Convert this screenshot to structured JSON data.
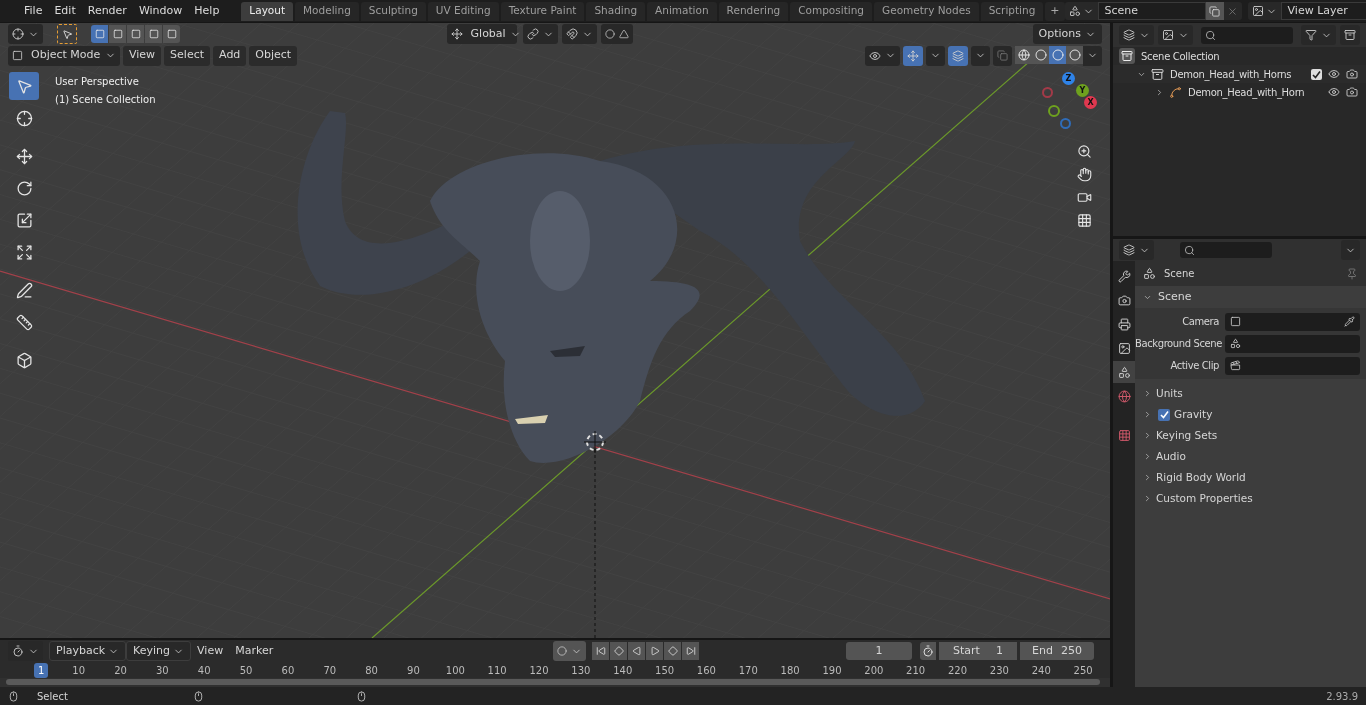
{
  "menu": [
    "File",
    "Edit",
    "Render",
    "Window",
    "Help"
  ],
  "workspaces": [
    {
      "label": "Layout",
      "selected": true
    },
    {
      "label": "Modeling",
      "selected": false
    },
    {
      "label": "Sculpting",
      "selected": false
    },
    {
      "label": "UV Editing",
      "selected": false
    },
    {
      "label": "Texture Paint",
      "selected": false
    },
    {
      "label": "Shading",
      "selected": false
    },
    {
      "label": "Animation",
      "selected": false
    },
    {
      "label": "Rendering",
      "selected": false
    },
    {
      "label": "Compositing",
      "selected": false
    },
    {
      "label": "Geometry Nodes",
      "selected": false
    },
    {
      "label": "Scripting",
      "selected": false
    }
  ],
  "add_workspace": "+",
  "scene_field": {
    "value": "Scene"
  },
  "view_layer_field": {
    "value": "View Layer"
  },
  "viewport": {
    "select_modes": [
      {
        "selected": true
      },
      {
        "selected": false
      },
      {
        "selected": false
      },
      {
        "selected": false
      },
      {
        "selected": false
      }
    ],
    "transform_orientation": "Global",
    "options": "Options",
    "mode": "Object Mode",
    "menus": [
      "View",
      "Select",
      "Add",
      "Object"
    ],
    "shading": [
      {
        "kind": "wireframe",
        "selected": false
      },
      {
        "kind": "solid",
        "selected": false
      },
      {
        "kind": "material",
        "selected": true
      },
      {
        "kind": "rendered",
        "selected": false
      }
    ],
    "overlay_text": [
      "User Perspective",
      "(1) Scene Collection"
    ],
    "tools": [
      {
        "kind": "select",
        "selected": true
      },
      {
        "kind": "cursor",
        "selected": false
      },
      {
        "kind": "move",
        "selected": false
      },
      {
        "kind": "rotate",
        "selected": false
      },
      {
        "kind": "scale",
        "selected": false
      },
      {
        "kind": "transform",
        "selected": false
      },
      {
        "kind": "annotate",
        "selected": false
      },
      {
        "kind": "measure",
        "selected": false
      },
      {
        "kind": "add_cube",
        "selected": false
      }
    ],
    "gizmo_axes": [
      {
        "label": "Z",
        "color": "#2f83e8"
      },
      {
        "label": "Y",
        "color": "#6ea11e"
      },
      {
        "label": "X",
        "color": "#e0384f"
      }
    ]
  },
  "outliner": {
    "tree": [
      {
        "label": "Scene Collection",
        "kind": "scene_collection",
        "children": [
          {
            "label": "Demon_Head_with_Horns",
            "kind": "collection",
            "expanded": true,
            "checked": true,
            "children": [
              {
                "label": "Demon_Head_with_Horn",
                "kind": "object",
                "expanded": false
              }
            ]
          }
        ]
      }
    ]
  },
  "properties": {
    "tabs": [
      {
        "kind": "tool",
        "selected": false
      },
      {
        "kind": "render",
        "selected": false
      },
      {
        "kind": "output",
        "selected": false
      },
      {
        "kind": "view_layer",
        "selected": false
      },
      {
        "kind": "scene",
        "selected": true
      },
      {
        "kind": "world",
        "selected": false
      },
      {
        "kind": "texture",
        "selected": false
      }
    ],
    "context": "Scene",
    "panel": {
      "title": "Scene",
      "expanded": true,
      "fields": [
        {
          "label": "Camera",
          "kind": "camera"
        },
        {
          "label": "Background Scene",
          "kind": "scene"
        },
        {
          "label": "Active Clip",
          "kind": "clip"
        }
      ]
    },
    "subpanels": [
      {
        "title": "Units",
        "expanded": false,
        "kind": "plain"
      },
      {
        "title": "Gravity",
        "expanded": false,
        "kind": "toggle",
        "checked": true
      },
      {
        "title": "Keying Sets",
        "expanded": false,
        "kind": "plain"
      },
      {
        "title": "Audio",
        "expanded": false,
        "kind": "plain"
      },
      {
        "title": "Rigid Body World",
        "expanded": false,
        "kind": "plain"
      },
      {
        "title": "Custom Properties",
        "expanded": false,
        "kind": "plain"
      }
    ]
  },
  "timeline": {
    "menus": [
      {
        "label": "Playback",
        "kind": "dropdown"
      },
      {
        "label": "Keying",
        "kind": "dropdown"
      },
      {
        "label": "View",
        "kind": "menu"
      },
      {
        "label": "Marker",
        "kind": "menu"
      }
    ],
    "current_frame": "1",
    "start_label": "Start",
    "start": "1",
    "end_label": "End",
    "end": "250",
    "ruler": [
      "1",
      "10",
      "20",
      "30",
      "40",
      "50",
      "60",
      "70",
      "80",
      "90",
      "100",
      "110",
      "120",
      "130",
      "140",
      "150",
      "160",
      "170",
      "180",
      "190",
      "200",
      "210",
      "220",
      "230",
      "240",
      "250"
    ]
  },
  "status_bar": {
    "action": "Select",
    "version": "2.93.9"
  }
}
